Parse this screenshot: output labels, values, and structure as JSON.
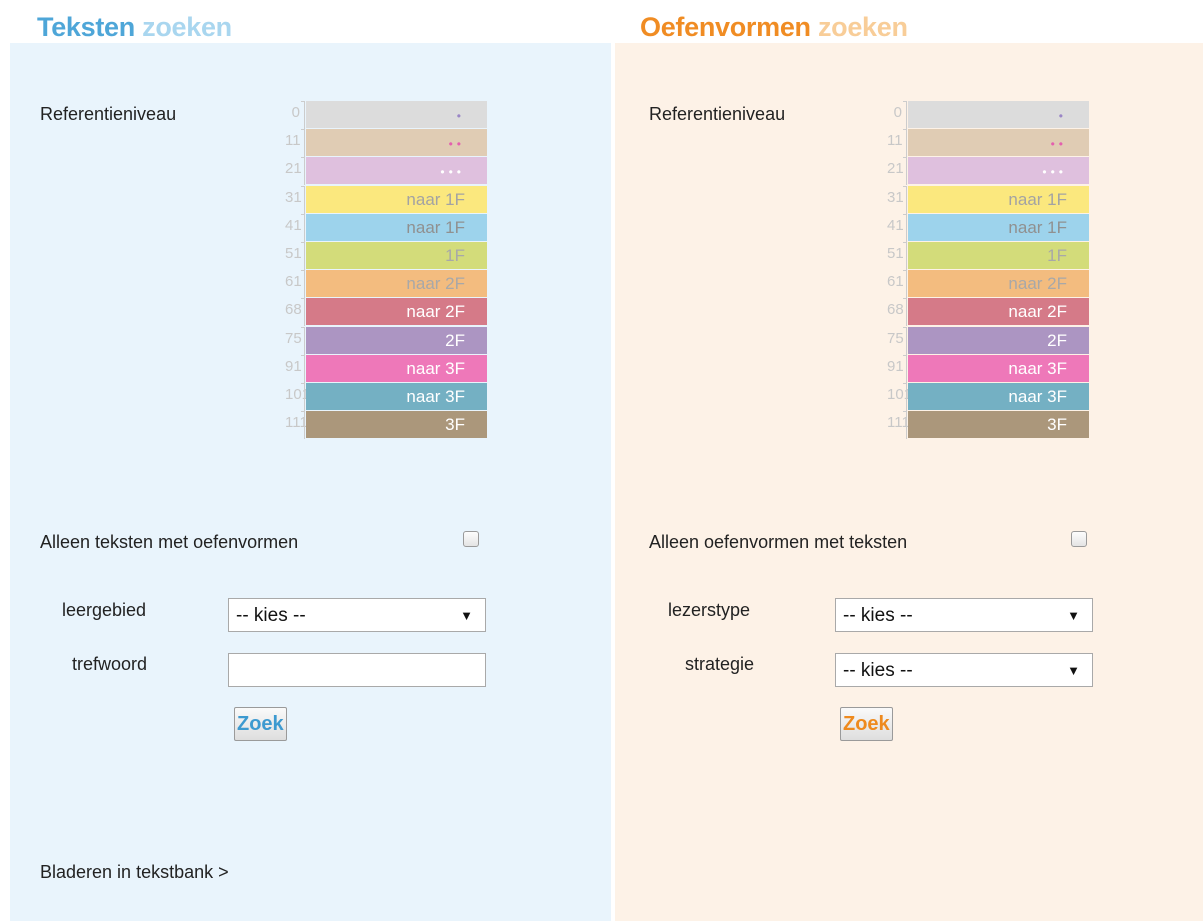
{
  "texts_panel": {
    "title_strong": "Teksten",
    "title_light": "zoeken",
    "level_label": "Referentieniveau",
    "only_with_label": "Alleen teksten met oefenvormen",
    "field1_label": "leergebied",
    "field1_value": "-- kies --",
    "field2_label": "trefwoord",
    "field2_value": "",
    "search_button": "Zoek",
    "browse_link": "Bladeren in tekstbank >"
  },
  "exercises_panel": {
    "title_strong": "Oefenvormen",
    "title_light": "zoeken",
    "level_label": "Referentieniveau",
    "only_with_label": "Alleen oefenvormen met teksten",
    "field1_label": "lezerstype",
    "field1_value": "-- kies --",
    "field2_label": "strategie",
    "field2_value": "-- kies --",
    "search_button": "Zoek"
  },
  "levels": [
    {
      "num": "0",
      "label": "•",
      "color": "#dcdcdc",
      "text_color": "#9a86c6",
      "dots": true
    },
    {
      "num": "11",
      "label": "••",
      "color": "#e0ccb4",
      "text_color": "#e45fae",
      "dots": true
    },
    {
      "num": "21",
      "label": "•••",
      "color": "#dfc0de",
      "text_color": "#ffffff",
      "dots": true
    },
    {
      "num": "31",
      "label": "naar 1F",
      "color": "#fbe87e",
      "text_color": "#a3a3a3",
      "dots": false
    },
    {
      "num": "41",
      "label": "naar 1F",
      "color": "#9dd3ec",
      "text_color": "#909090",
      "dots": false
    },
    {
      "num": "51",
      "label": "1F",
      "color": "#d3dc7a",
      "text_color": "#a8a8a8",
      "dots": false
    },
    {
      "num": "61",
      "label": "naar 2F",
      "color": "#f3bc7f",
      "text_color": "#a8a8a8",
      "dots": false
    },
    {
      "num": "68",
      "label": "naar 2F",
      "color": "#d57a88",
      "text_color": "#ffffff",
      "dots": false
    },
    {
      "num": "75",
      "label": "2F",
      "color": "#ac95c2",
      "text_color": "#ffffff",
      "dots": false
    },
    {
      "num": "91",
      "label": "naar 3F",
      "color": "#ee78b9",
      "text_color": "#ffffff",
      "dots": false
    },
    {
      "num": "101",
      "label": "naar 3F",
      "color": "#74b0c3",
      "text_color": "#ffffff",
      "dots": false
    },
    {
      "num": "111",
      "label": "3F",
      "color": "#ab977b",
      "text_color": "#ffffff",
      "dots": false
    }
  ]
}
